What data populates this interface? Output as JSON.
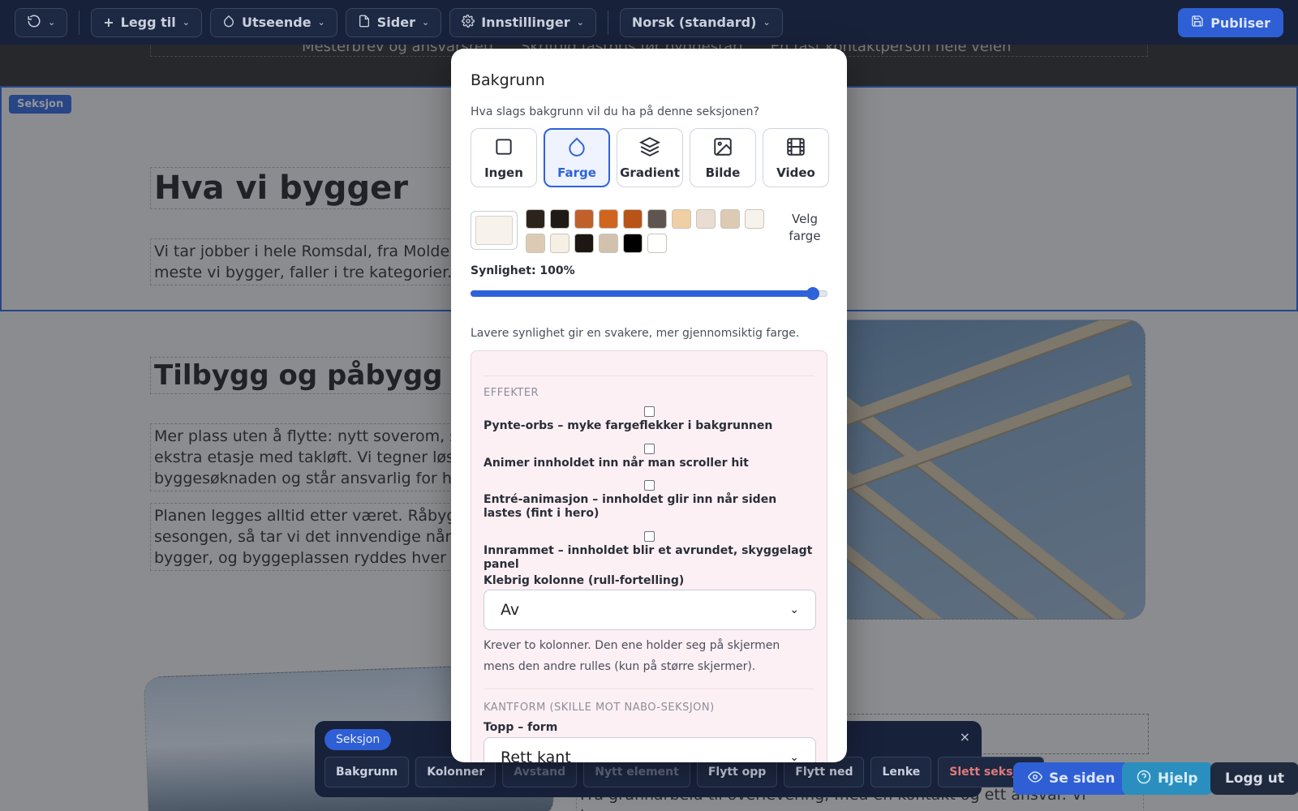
{
  "toolbar": {
    "undo_label": "",
    "add": "Legg til",
    "look": "Utseende",
    "pages": "Sider",
    "settings": "Innstillinger",
    "language": "Norsk (standard)",
    "publish": "Publiser"
  },
  "canvas": {
    "hero_items": [
      "Mesterbrev og ansvarsrett",
      "Skriftlig fastpris før byggestart",
      "En fast kontaktperson hele veien"
    ],
    "section_badge": "Seksjon",
    "heading1": "Hva vi bygger",
    "intro": "Vi tar jobber i hele Romsdal, fra Molde se… meste vi bygger, faller i tre kategorier.",
    "intro_line1": "Vi tar jobber i hele Romsdal, fra Molde se",
    "intro_line2": "meste vi bygger, faller i tre kategorier.",
    "heading2": "Tilbygg og påbygg",
    "p1_lines": [
      "Mer plass uten å flytte: nytt soverom, stør",
      "ekstra etasje med takløft. Vi tegner løsnin",
      "byggesøknaden og står ansvarlig for hele"
    ],
    "p2_lines": [
      "Planen legges alltid etter været. Råbygge",
      "sesongen, så tar vi det innvendige når hu",
      "bygger, og byggeplassen ryddes hver en"
    ],
    "bottom_text": "Fra grunnarbeid til overlevering, med én kontakt og ett ansvar. Vi bygger"
  },
  "modal": {
    "title": "Bakgrunn",
    "question": "Hva slags bakgrunn vil du ha på denne seksjonen?",
    "types": [
      {
        "label": "Ingen",
        "icon": "square-icon",
        "selected": false
      },
      {
        "label": "Farge",
        "icon": "droplet-icon",
        "selected": true
      },
      {
        "label": "Gradient",
        "icon": "layers-icon",
        "selected": false
      },
      {
        "label": "Bilde",
        "icon": "image-icon",
        "selected": false
      },
      {
        "label": "Video",
        "icon": "film-icon",
        "selected": false
      }
    ],
    "current_color": "#f7f3ec",
    "swatches": [
      "#2b241d",
      "#1f1a15",
      "#c0602a",
      "#d0651f",
      "#b85418",
      "#5e5550",
      "#f0cfa4",
      "#e8ddd0",
      "#dccab2",
      "#f7f3ec",
      "#dccbb4",
      "#f6efe4",
      "#1c1712",
      "#d2c2ad",
      "#000000",
      "#ffffff"
    ],
    "pick_color": "Velg farge",
    "opacity_label": "Synlighet: 100%",
    "opacity_value": 0.96,
    "opacity_hint": "Lavere synlighet gir en svakere, mer gjennomsiktig farge.",
    "effects_heading": "EFFEKTER",
    "effects": [
      "Pynte-orbs – myke fargeflekker i bakgrunnen",
      "Animer innholdet inn når man scroller hit",
      "Entré-animasjon – innholdet glir inn når siden lastes (fint i hero)",
      "Innrammet – innholdet blir et avrundet, skyggelagt panel"
    ],
    "sticky_label": "Klebrig kolonne (rull-fortelling)",
    "sticky_value": "Av",
    "sticky_note": "Krever to kolonner. Den ene holder seg på skjermen mens den andre rulles (kun på større skjermer).",
    "edge_heading": "KANTFORM (SKILLE MOT NABO-SEKSJON)",
    "top_shape_label": "Topp – form",
    "top_shape_value": "Rett kant"
  },
  "section_bar": {
    "tag": "Seksjon",
    "close": "×",
    "buttons": [
      "Bakgrunn",
      "Kolonner",
      "Avstand",
      "Nytt element",
      "Flytt opp",
      "Flytt ned",
      "Lenke",
      "Slett seksjon"
    ]
  },
  "floating": {
    "see_page": "Se siden",
    "help": "Hjelp",
    "logout": "Logg ut"
  },
  "colors": {
    "accent": "#2f62d8",
    "toolbar_bg": "#17213a",
    "danger": "#e07b7b"
  }
}
